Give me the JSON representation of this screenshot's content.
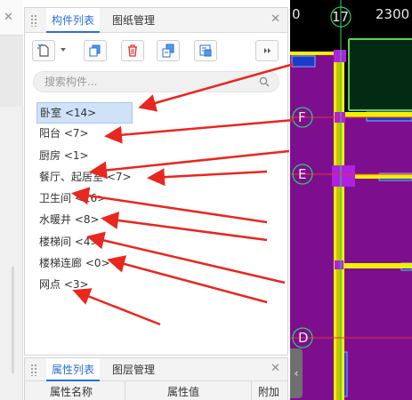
{
  "component_panel": {
    "tabs": [
      {
        "label": "构件列表",
        "active": true
      },
      {
        "label": "图纸管理",
        "active": false
      }
    ],
    "toolbar": [
      "new-component",
      "copy",
      "delete",
      "duplicate",
      "layer-copy",
      "more"
    ],
    "search": {
      "placeholder": "搜索构件..."
    },
    "items": [
      {
        "label": "卧室 <14>",
        "selected": true
      },
      {
        "label": "阳台 <7>"
      },
      {
        "label": "厨房 <1>"
      },
      {
        "label": "餐厅、起居室 <7>"
      },
      {
        "label": "卫生间 <16>"
      },
      {
        "label": "水暖井 <8>"
      },
      {
        "label": "楼梯间 <4>"
      },
      {
        "label": "楼梯连廊 <0>"
      },
      {
        "label": "网点 <3>"
      }
    ]
  },
  "property_panel": {
    "tabs": [
      {
        "label": "属性列表",
        "active": true
      },
      {
        "label": "图层管理",
        "active": false
      }
    ],
    "columns": [
      "属性名称",
      "属性值",
      "附加"
    ]
  },
  "cad": {
    "top_labels": [
      "0",
      "17",
      "2300"
    ],
    "axis_labels": [
      "F",
      "E",
      "D"
    ]
  },
  "colors": {
    "accent": "#2a6fd6",
    "selected_bg": "#cfe2f8",
    "arrow": "#e8271f",
    "room_fill": "#7d0f8e",
    "wall_yellow": "#f3f000"
  }
}
